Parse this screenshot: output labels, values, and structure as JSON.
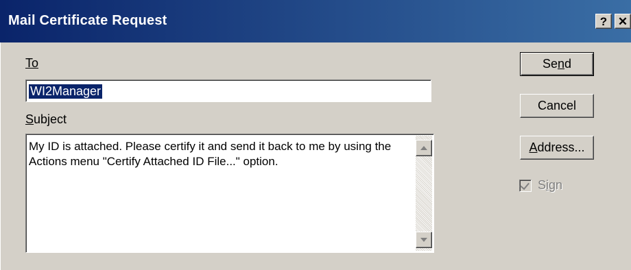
{
  "window": {
    "title": "Mail Certificate Request",
    "help_glyph": "?",
    "close_glyph": "✕"
  },
  "form": {
    "to_label": "To",
    "to_value": "WI2Manager",
    "subject_label": "Subject",
    "subject_value": "My ID is attached.  Please certify it and send it back to me by using the Actions menu \"Certify Attached ID File...\" option."
  },
  "buttons": {
    "send": {
      "pre": "Se",
      "acc": "n",
      "post": "d"
    },
    "cancel": "Cancel",
    "address": {
      "pre": "",
      "acc": "A",
      "post": "ddress..."
    }
  },
  "sign": {
    "pre": "S",
    "acc": "i",
    "post": "gn",
    "checked": true,
    "enabled": false
  },
  "colors": {
    "titlebar_start": "#0a246a",
    "titlebar_end": "#3a6ea5",
    "dialog_bg": "#d4d0c8",
    "selection_bg": "#0a246a"
  }
}
